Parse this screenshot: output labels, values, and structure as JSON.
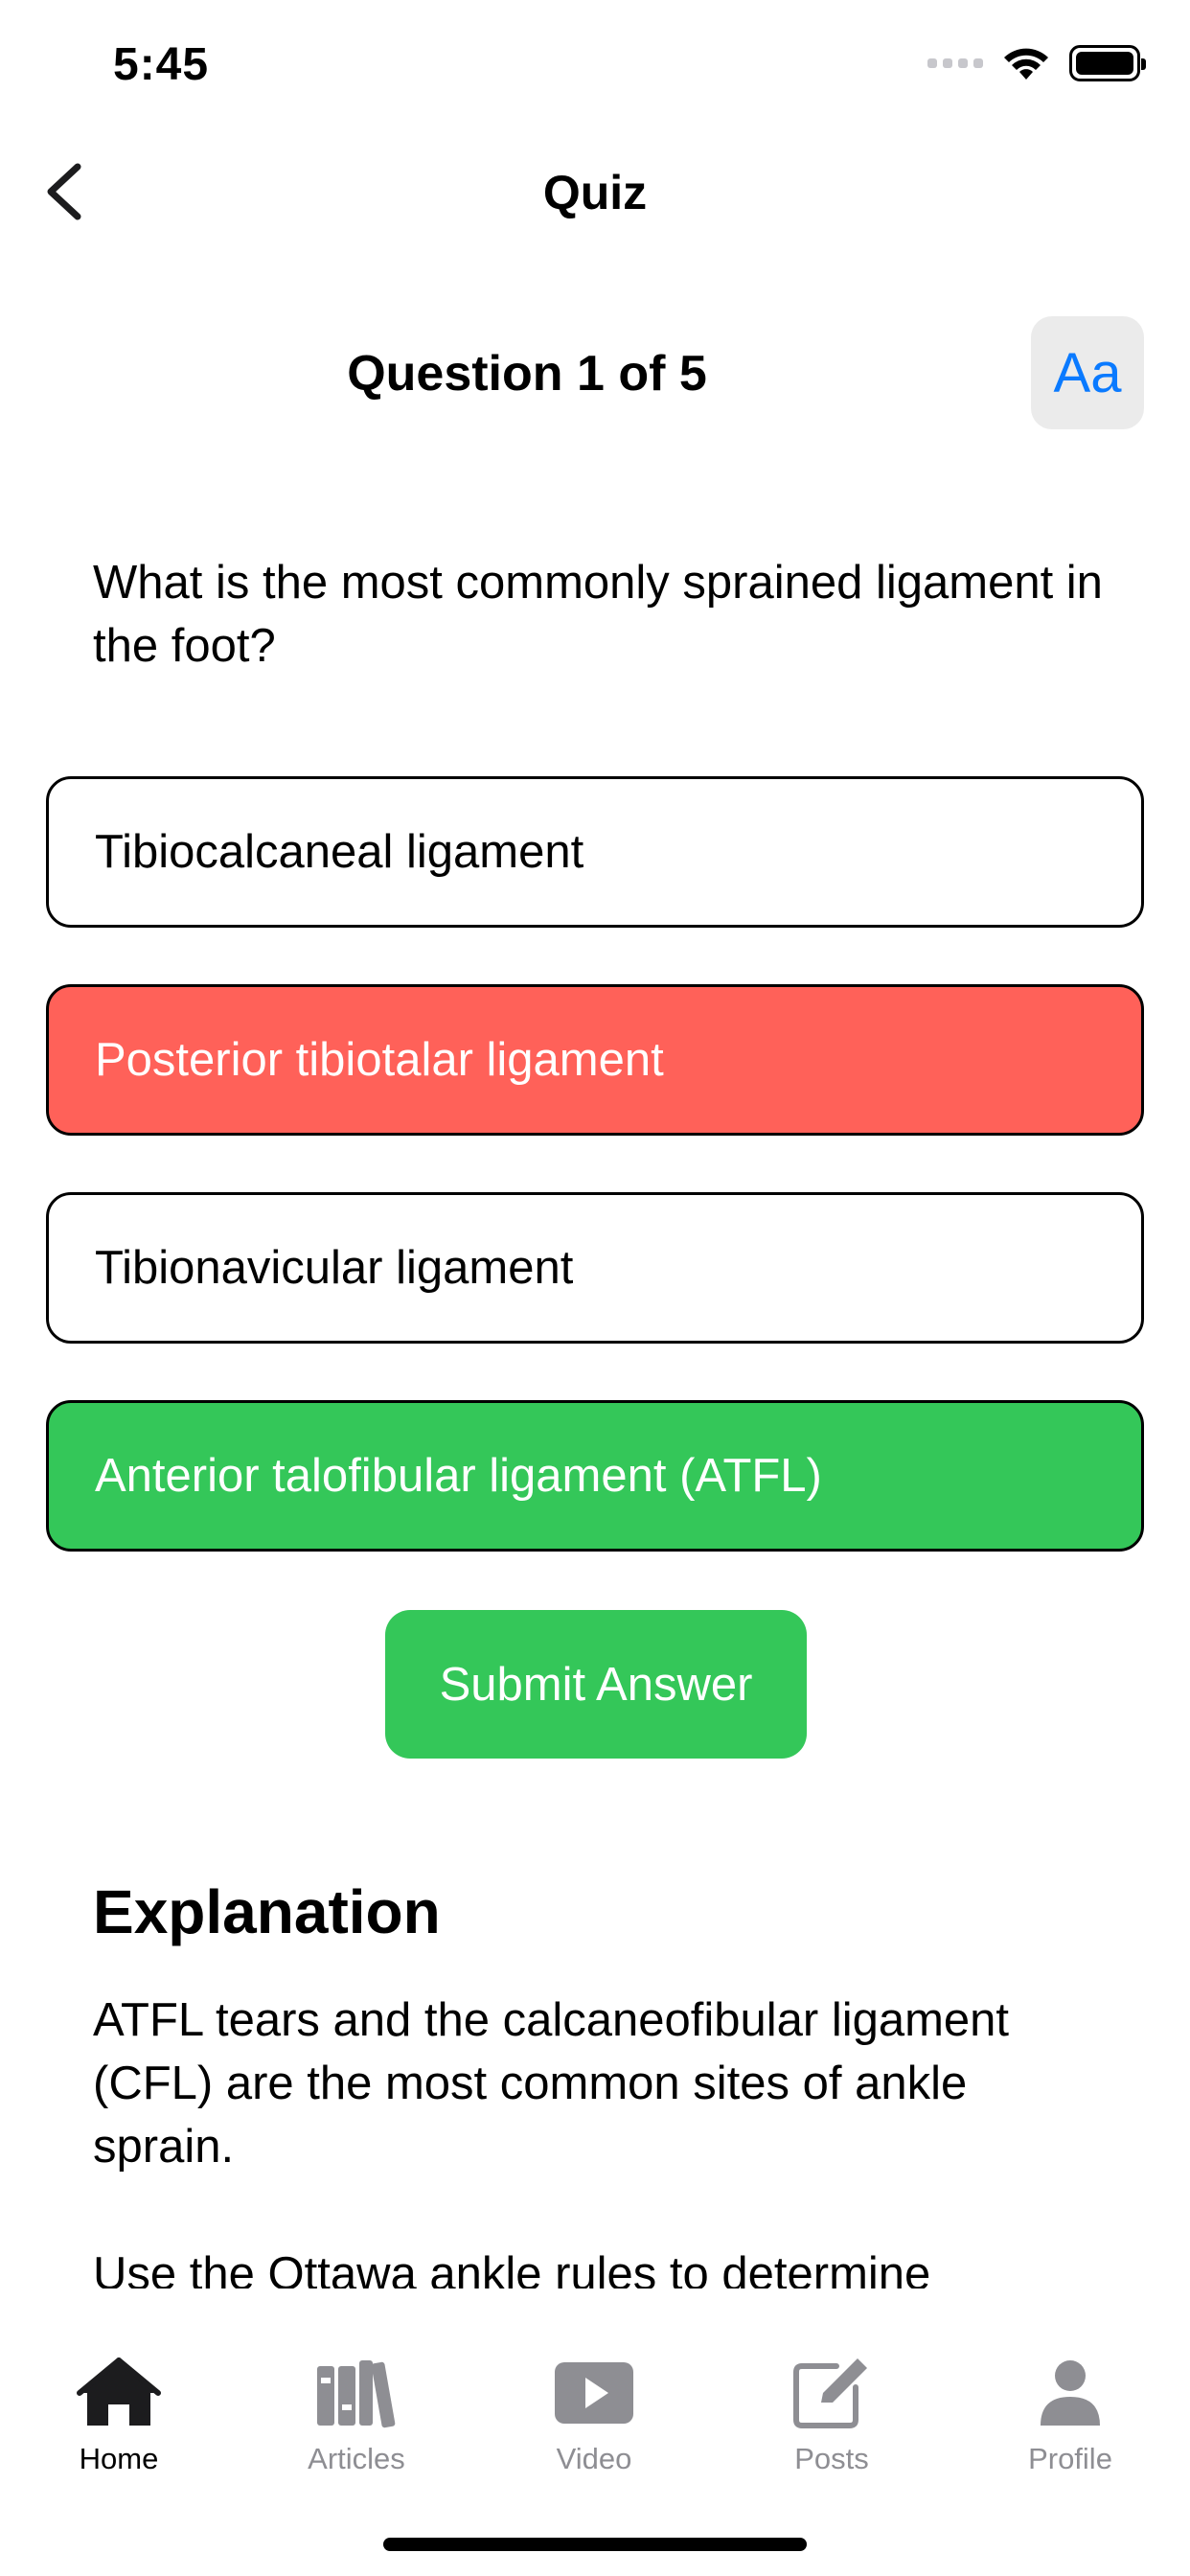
{
  "status_bar": {
    "time": "5:45"
  },
  "nav": {
    "title": "Quiz",
    "back_icon": "chevron-left-icon"
  },
  "question": {
    "counter": "Question 1 of 5",
    "font_button": "Aa",
    "text": "What is the most commonly sprained ligament in the foot?"
  },
  "options": [
    {
      "label": "Tibiocalcaneal ligament",
      "state": "default"
    },
    {
      "label": "Posterior tibiotalar ligament",
      "state": "wrong"
    },
    {
      "label": "Tibionavicular ligament",
      "state": "default"
    },
    {
      "label": "Anterior talofibular ligament (ATFL)",
      "state": "correct"
    }
  ],
  "submit": {
    "label": "Submit Answer"
  },
  "explanation": {
    "title": "Explanation",
    "body": "ATFL tears and the calcaneofibular ligament (CFL) are the most common sites of ankle sprain.",
    "body_cut": "Use the Ottawa ankle rules to determine"
  },
  "tabs": [
    {
      "label": "Home",
      "icon": "home-icon",
      "active": true
    },
    {
      "label": "Articles",
      "icon": "books-icon",
      "active": false
    },
    {
      "label": "Video",
      "icon": "play-icon",
      "active": false
    },
    {
      "label": "Posts",
      "icon": "compose-icon",
      "active": false
    },
    {
      "label": "Profile",
      "icon": "person-icon",
      "active": false
    }
  ],
  "colors": {
    "accent_blue": "#0a7aff",
    "wrong_red": "#ff6159",
    "correct_green": "#34c759",
    "tab_inactive": "#8e8e93"
  }
}
